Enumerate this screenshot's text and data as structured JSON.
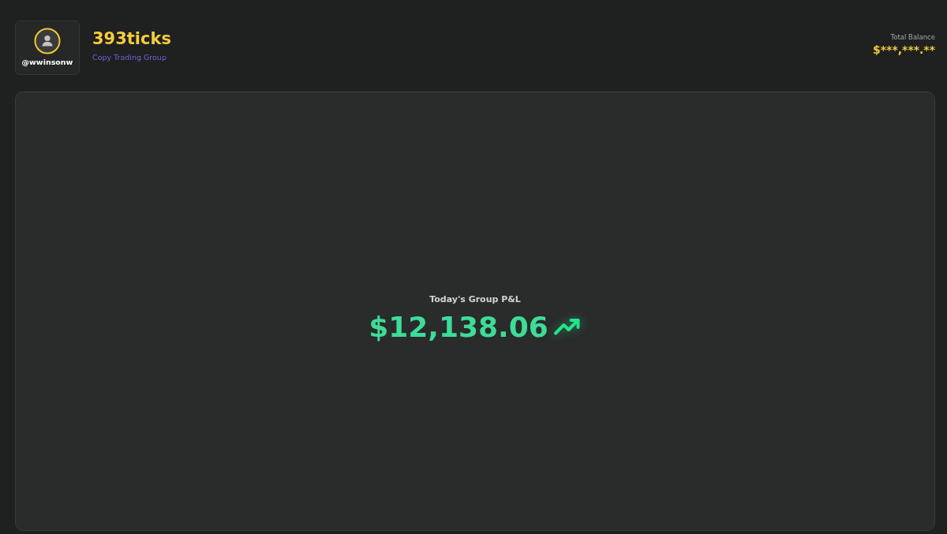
{
  "header": {
    "profile": {
      "username": "@wwinsonw"
    },
    "title": "393ticks",
    "subtitle": "Copy Trading Group"
  },
  "balance": {
    "label": "Total Balance",
    "value": "$***,***.**"
  },
  "pnl": {
    "label": "Today's Group P&L",
    "value": "$12,138.06",
    "positive": true
  }
}
